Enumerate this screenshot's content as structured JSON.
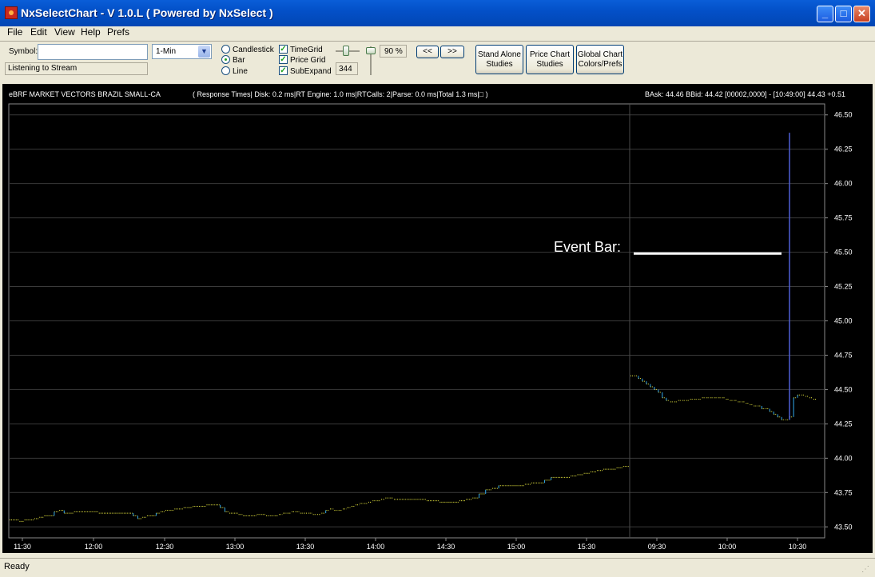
{
  "window": {
    "title": "NxSelectChart - V 1.0.L ( Powered by NxSelect )"
  },
  "menu": [
    {
      "key": "File",
      "label": "File"
    },
    {
      "key": "Edit",
      "label": "Edit"
    },
    {
      "key": "View",
      "label": "View"
    },
    {
      "key": "Help",
      "label": "Help"
    },
    {
      "key": "Prefs",
      "label": "Prefs"
    }
  ],
  "toolbar": {
    "symbol_label": "Symbol:",
    "symbol_value": "",
    "interval": "1-Min",
    "stream_status": "Listening to Stream",
    "chart_types": [
      {
        "key": "candlestick",
        "label": "Candlestick",
        "selected": false
      },
      {
        "key": "bar",
        "label": "Bar",
        "selected": true
      },
      {
        "key": "line",
        "label": "Line",
        "selected": false
      }
    ],
    "options": [
      {
        "key": "time-grid",
        "label": "TimeGrid",
        "checked": true
      },
      {
        "key": "price-grid",
        "label": "Price Grid",
        "checked": true
      },
      {
        "key": "sub-expand",
        "label": "SubExpand",
        "checked": true
      }
    ],
    "zoom_value": "344",
    "percent": "90 %",
    "prev_label": "<<",
    "next_label": ">>",
    "buttons": [
      {
        "key": "stand-alone-studies",
        "line1": "Stand Alone",
        "line2": "Studies"
      },
      {
        "key": "price-chart-studies",
        "line1": "Price Chart",
        "line2": "Studies"
      },
      {
        "key": "global-chart-colors",
        "line1": "Global Chart",
        "line2": "Colors/Prefs"
      }
    ]
  },
  "chart_header": {
    "symbol_desc": "eBRF MARKET VECTORS BRAZIL SMALL-CA",
    "response_times": "( Response Times| Disk: 0.2 ms|RT Engine: 1.0 ms|RTCalls: 2|Parse: 0.0 ms|Total 1.3 ms|□ )",
    "quote": "BAsk: 44.46  BBid: 44.42  [00002,0000]  -  [10:49:00]  44.43  +0.51"
  },
  "annotation": {
    "label": "Event Bar:"
  },
  "status": {
    "text": "Ready"
  },
  "colors": {
    "bar": "#33aaee",
    "tick": "#e8e840",
    "grid": "#3a3a3a",
    "event_line": "#4f5fd6"
  },
  "chart_data": {
    "type": "bar",
    "y_ticks": [
      "46.50",
      "46.25",
      "46.00",
      "45.75",
      "45.50",
      "45.25",
      "45.00",
      "44.75",
      "44.50",
      "44.25",
      "44.00",
      "43.75",
      "43.50"
    ],
    "ylim": [
      43.42,
      46.58
    ],
    "x_ticks": [
      "11:30",
      "12:00",
      "12:30",
      "13:00",
      "13:30",
      "14:00",
      "14:30",
      "15:00",
      "15:30",
      "09:30",
      "10:00",
      "10:30"
    ],
    "grid": true,
    "session_break_after": "15:58",
    "series": [
      {
        "x": "11:30",
        "values": [
          43.55,
          43.55,
          43.54,
          43.55,
          43.55,
          43.56,
          43.57,
          43.58,
          43.58,
          43.61,
          43.62,
          43.6,
          43.6,
          43.61,
          43.61,
          43.61,
          43.61,
          43.61,
          43.6,
          43.6,
          43.6,
          43.6,
          43.6,
          43.6
        ]
      },
      {
        "x": "12:30",
        "values": [
          43.6,
          43.58,
          43.56,
          43.57,
          43.58,
          43.58,
          43.6,
          43.61,
          43.62,
          43.62,
          43.63,
          43.63,
          43.64,
          43.64,
          43.65,
          43.65,
          43.65,
          43.66,
          43.66,
          43.66,
          43.64,
          43.61,
          43.6,
          43.6,
          43.59,
          43.58,
          43.58,
          43.58,
          43.59,
          43.59
        ]
      },
      {
        "x": "13:30",
        "values": [
          43.58,
          43.58,
          43.58,
          43.59,
          43.6,
          43.6,
          43.61,
          43.61,
          43.6,
          43.6,
          43.6,
          43.59,
          43.59,
          43.6,
          43.62,
          43.63,
          43.62,
          43.62,
          43.63,
          43.64,
          43.65,
          43.66,
          43.67,
          43.67,
          43.68,
          43.69,
          43.69,
          43.7,
          43.71,
          43.71
        ]
      },
      {
        "x": "14:30",
        "values": [
          43.7,
          43.7,
          43.7,
          43.7,
          43.7,
          43.69,
          43.69,
          43.68,
          43.68,
          43.68,
          43.69,
          43.7,
          43.71,
          43.74,
          43.77,
          43.78,
          43.8,
          43.8,
          43.8,
          43.8,
          43.81,
          43.82,
          43.82,
          43.84,
          43.86,
          43.86,
          43.86,
          43.87,
          43.88,
          43.89,
          43.9,
          43.91,
          43.92,
          43.92,
          43.93,
          43.94
        ]
      },
      {
        "x": "09:30",
        "values": [
          44.6,
          44.6,
          44.58,
          44.56,
          44.54,
          44.52,
          44.5,
          44.48,
          44.44,
          44.42,
          44.41,
          44.41,
          44.42,
          44.42,
          44.42,
          44.43,
          44.43,
          44.43,
          44.44,
          44.44,
          44.44,
          44.44,
          44.44,
          44.44,
          44.43,
          44.42,
          44.42,
          44.41,
          44.41,
          44.4,
          44.39,
          44.38,
          44.38,
          44.36,
          44.36,
          44.34,
          44.32,
          44.3,
          44.28,
          44.28,
          44.3,
          44.44,
          44.46,
          44.46,
          44.45,
          44.44,
          44.43
        ]
      }
    ],
    "event_bar": {
      "time": "10:27",
      "high": 46.37,
      "low": 44.28
    }
  }
}
